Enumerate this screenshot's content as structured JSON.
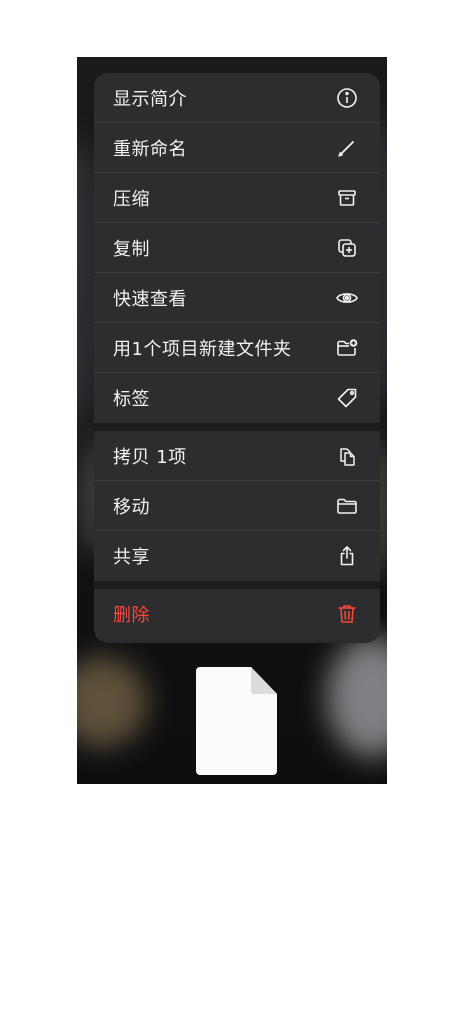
{
  "menu": {
    "group1": [
      {
        "label": "显示简介",
        "icon": "info-circle-icon"
      },
      {
        "label": "重新命名",
        "icon": "pencil-icon"
      },
      {
        "label": "压缩",
        "icon": "archive-box-icon"
      },
      {
        "label": "复制",
        "icon": "duplicate-plus-icon"
      },
      {
        "label": "快速查看",
        "icon": "eye-icon"
      },
      {
        "label": "用1个项目新建文件夹",
        "icon": "folder-plus-icon"
      },
      {
        "label": "标签",
        "icon": "tag-icon"
      }
    ],
    "group2": [
      {
        "label": "拷贝 1项",
        "icon": "copy-documents-icon"
      },
      {
        "label": "移动",
        "icon": "folder-icon"
      },
      {
        "label": "共享",
        "icon": "share-icon"
      }
    ],
    "delete": {
      "label": "删除",
      "icon": "trash-icon",
      "color": "#ff453a"
    }
  }
}
